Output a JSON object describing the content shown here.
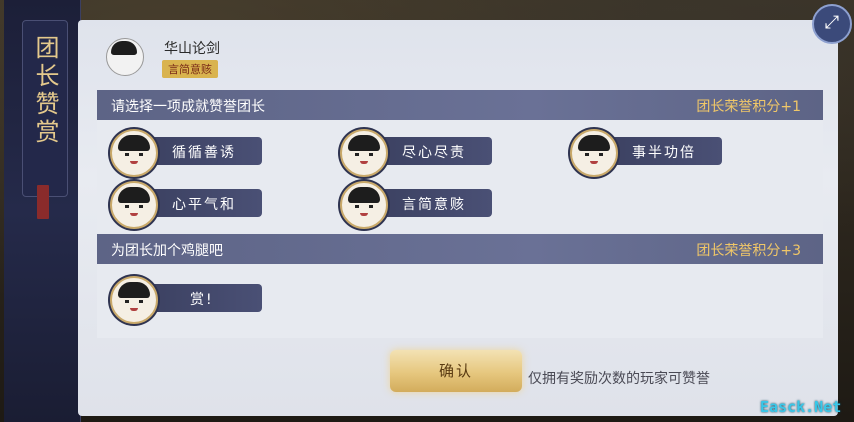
{
  "banner": {
    "title": "团长赞赏"
  },
  "leader": {
    "name": "华山论剑",
    "tag": "言简意赅"
  },
  "sections": [
    {
      "title": "请选择一项成就赞誉团长",
      "points": "团长荣誉积分+1",
      "options": [
        "循循善诱",
        "尽心尽责",
        "事半功倍",
        "心平气和",
        "言简意赅"
      ]
    },
    {
      "title": "为团长加个鸡腿吧",
      "points": "团长荣誉积分+3",
      "options": [
        "赏!"
      ]
    }
  ],
  "confirm": "确认",
  "hint": "仅拥有奖励次数的玩家可赞誉",
  "watermark": "Easck.Net",
  "colors": {
    "gold": "#f0c768",
    "bar": "#5d6486",
    "pill": "#3a3f5f"
  },
  "icons": {
    "expand": "expand-icon"
  }
}
